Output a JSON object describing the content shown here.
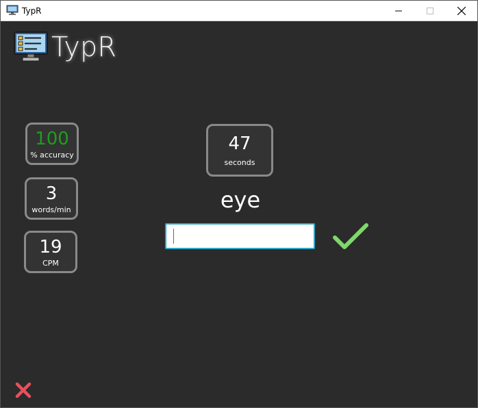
{
  "window": {
    "title": "TypR",
    "minimize_glyph": "—",
    "maximize_glyph": "☐",
    "close_glyph": "✕"
  },
  "logo": {
    "text": "TypR",
    "icon": "monitor-checklist-icon"
  },
  "stats": {
    "accuracy": {
      "value": "100",
      "label": "% accuracy",
      "color": "#1e9e1e"
    },
    "wpm": {
      "value": "3",
      "label": "words/min"
    },
    "cpm": {
      "value": "19",
      "label": "CPM"
    }
  },
  "timer": {
    "value": "47",
    "label": "seconds"
  },
  "prompt_word": "eye",
  "input": {
    "value": "",
    "placeholder": ""
  },
  "icons": {
    "submit": "checkmark-icon",
    "quit": "x-mark-icon",
    "check_color": "#7ed86a",
    "x_color": "#e8505b"
  }
}
